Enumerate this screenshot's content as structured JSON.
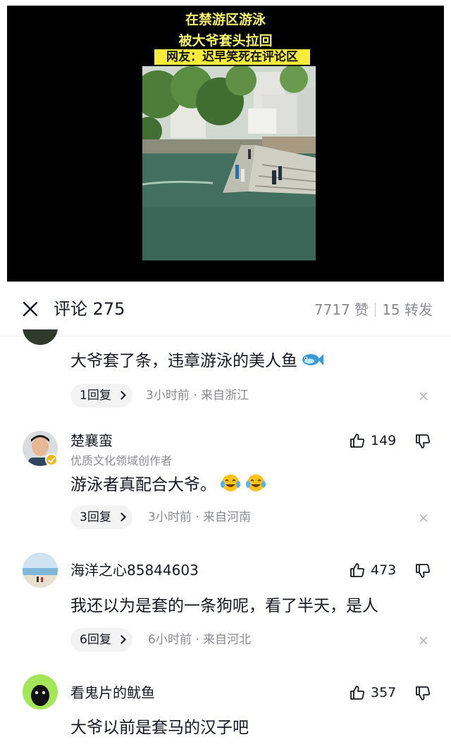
{
  "video": {
    "caption_line1": "在禁游区游泳",
    "caption_line2": "被大爷套头拉回",
    "caption_line3": "网友：迟早笑死在评论区"
  },
  "header": {
    "title": "评论 275",
    "likes": "7717 赞",
    "shares": "15 转发",
    "close_icon": "close-icon"
  },
  "comments": [
    {
      "text": "大爷套了条，违章游泳的美人鱼",
      "emoji": "fish-emoji",
      "reply_label": "1回复",
      "meta": "3小时前 · 来自浙江"
    },
    {
      "username": "楚襄蛮",
      "tag": "优质文化领域创作者",
      "text": "游泳者真配合大爷。",
      "emoji": "laugh-cry-emoji",
      "like_count": "149",
      "reply_label": "3回复",
      "meta": "3小时前 · 来自河南"
    },
    {
      "username": "海洋之心85844603",
      "text": "我还以为是套的一条狗呢，看了半天，是人",
      "like_count": "473",
      "reply_label": "6回复",
      "meta": "6小时前 · 来自河北"
    },
    {
      "username": "看鬼片的鱿鱼",
      "text": "大爷以前是套马的汉子吧",
      "like_count": "357"
    }
  ],
  "colors": {
    "caption_yellow": "#f4f26a",
    "caption_highlight": "#f7ec3b",
    "muted_text": "#8a8b91",
    "verified_badge": "#f2b31b"
  }
}
